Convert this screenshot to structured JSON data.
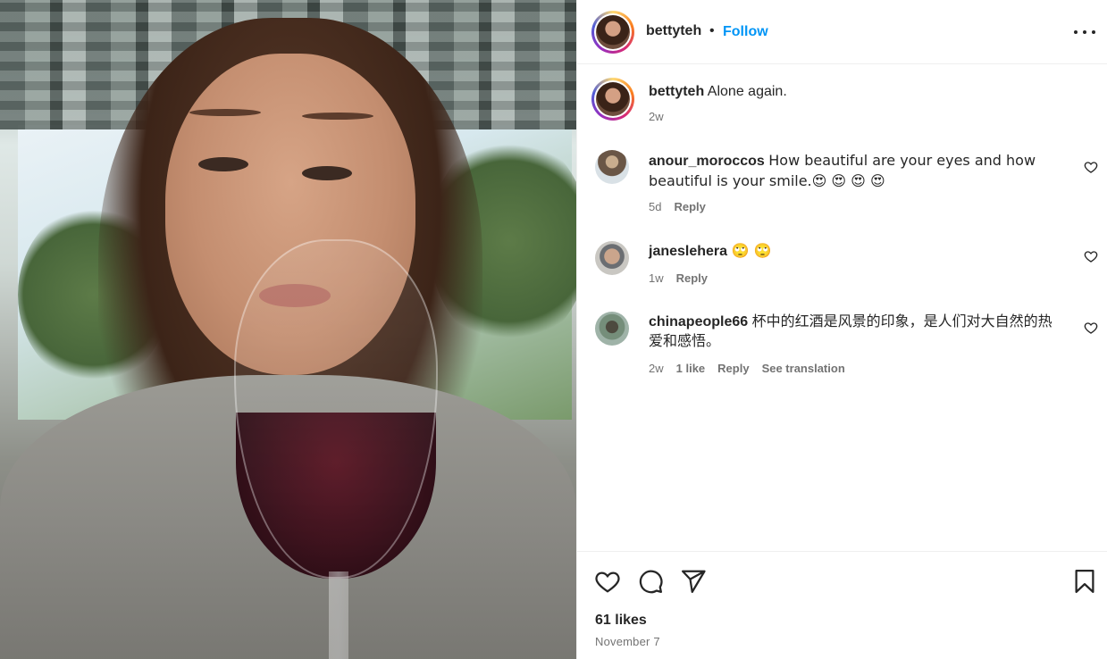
{
  "post": {
    "username": "bettyteh",
    "separator": "•",
    "follow_label": "Follow",
    "caption_username": "bettyteh",
    "caption_text": "Alone again.",
    "caption_time": "2w"
  },
  "comments": [
    {
      "username": "anour_moroccos",
      "text": "How beautiful are your eyes and how beautiful is your smile.😍 😍 😍 😍",
      "time": "5d",
      "reply_label": "Reply"
    },
    {
      "username": "janeslehera",
      "text": "🙄 🙄",
      "time": "1w",
      "reply_label": "Reply"
    },
    {
      "username": "chinapeople66",
      "text": "杯中的红酒是风景的印象，是人们对大自然的热爱和感悟。",
      "time": "2w",
      "likes_label": "1 like",
      "reply_label": "Reply",
      "translate_label": "See translation"
    }
  ],
  "footer": {
    "likes": "61 likes",
    "date": "November 7"
  },
  "icons": {
    "like": "heart-icon",
    "comment": "comment-icon",
    "share": "share-icon",
    "save": "bookmark-icon",
    "more": "more-options-icon"
  },
  "colors": {
    "follow": "#0095f6",
    "text": "#262626",
    "muted": "#737373"
  }
}
